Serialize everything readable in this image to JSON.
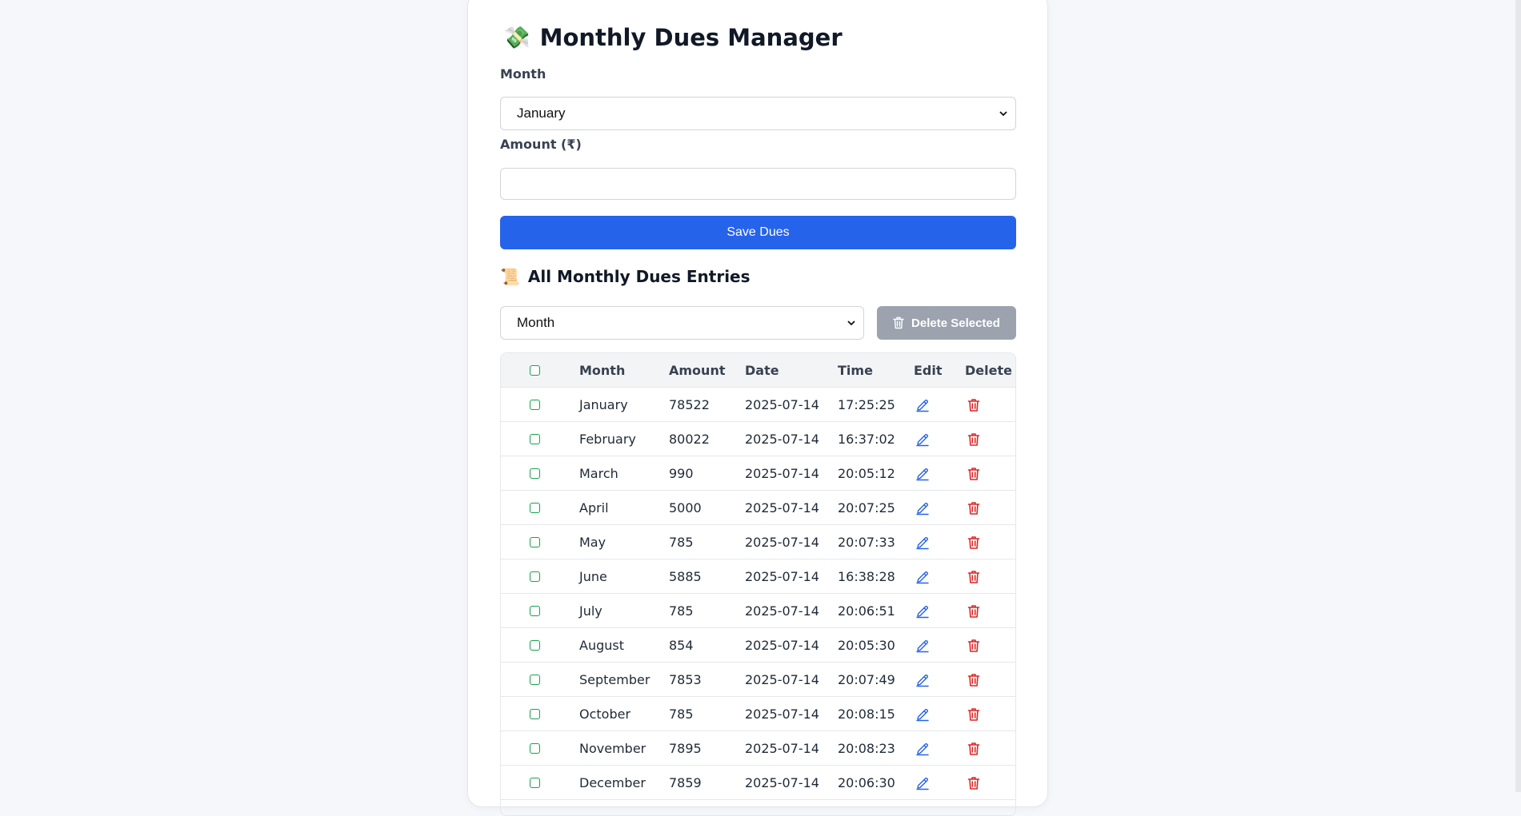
{
  "app": {
    "title": "Monthly Dues Manager",
    "title_emoji": "💸"
  },
  "form": {
    "month_label": "Month",
    "month_value": "January",
    "amount_label": "Amount (₹)",
    "amount_value": "",
    "save_label": "Save Dues"
  },
  "entries": {
    "heading": "All Monthly Dues Entries",
    "heading_emoji": "📜",
    "filter_value": "Month",
    "delete_selected_label": "Delete Selected",
    "columns": [
      "Month",
      "Amount",
      "Date",
      "Time",
      "Edit",
      "Delete"
    ],
    "rows": [
      {
        "month": "January",
        "amount": "78522",
        "date": "2025-07-14",
        "time": "17:25:25"
      },
      {
        "month": "February",
        "amount": "80022",
        "date": "2025-07-14",
        "time": "16:37:02"
      },
      {
        "month": "March",
        "amount": "990",
        "date": "2025-07-14",
        "time": "20:05:12"
      },
      {
        "month": "April",
        "amount": "5000",
        "date": "2025-07-14",
        "time": "20:07:25"
      },
      {
        "month": "May",
        "amount": "785",
        "date": "2025-07-14",
        "time": "20:07:33"
      },
      {
        "month": "June",
        "amount": "5885",
        "date": "2025-07-14",
        "time": "16:38:28"
      },
      {
        "month": "July",
        "amount": "785",
        "date": "2025-07-14",
        "time": "20:06:51"
      },
      {
        "month": "August",
        "amount": "854",
        "date": "2025-07-14",
        "time": "20:05:30"
      },
      {
        "month": "September",
        "amount": "7853",
        "date": "2025-07-14",
        "time": "20:07:49"
      },
      {
        "month": "October",
        "amount": "785",
        "date": "2025-07-14",
        "time": "20:08:15"
      },
      {
        "month": "November",
        "amount": "7895",
        "date": "2025-07-14",
        "time": "20:08:23"
      },
      {
        "month": "December",
        "amount": "7859",
        "date": "2025-07-14",
        "time": "20:06:30"
      }
    ]
  },
  "colors": {
    "primary": "#2563eb",
    "disabled": "#9ca3af",
    "edit_icon": "#2563eb",
    "delete_icon": "#dc2626",
    "checkbox": "#16a34a"
  },
  "icons": {
    "edit": "pencil-icon",
    "delete": "trash-icon",
    "select": "chevron-down-icon"
  }
}
